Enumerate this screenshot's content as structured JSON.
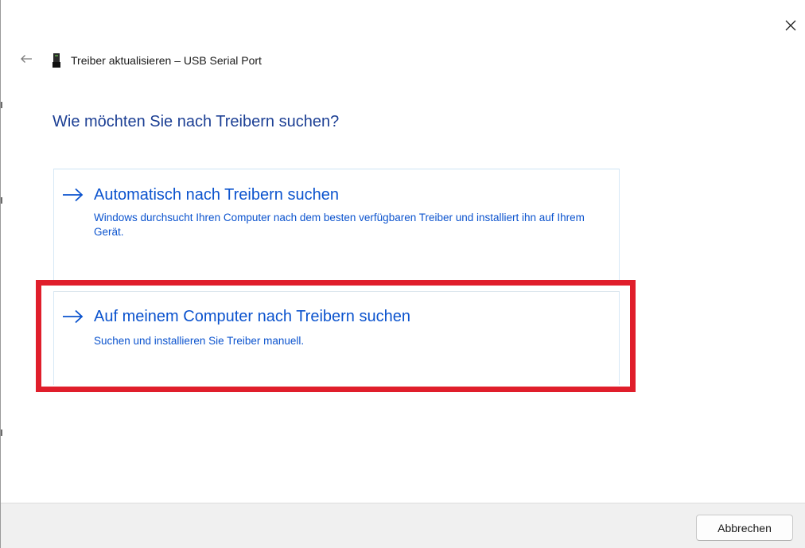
{
  "window": {
    "title": "Treiber aktualisieren – USB Serial Port"
  },
  "icons": {
    "close": "close-icon",
    "back": "back-arrow-icon",
    "device": "usb-device-icon",
    "option_arrow": "right-arrow-icon"
  },
  "main": {
    "heading": "Wie möchten Sie nach Treibern suchen?",
    "options": [
      {
        "title": "Automatisch nach Treibern suchen",
        "description": "Windows durchsucht Ihren Computer nach dem besten verfügbaren Treiber und installiert ihn auf Ihrem Gerät."
      },
      {
        "title": "Auf meinem Computer nach Treibern suchen",
        "description": "Suchen und installieren Sie Treiber manuell.",
        "highlighted": true
      }
    ]
  },
  "footer": {
    "cancel_label": "Abbrechen"
  },
  "colors": {
    "heading": "#1c3f94",
    "link": "#0b53ce",
    "highlight": "#e01e2b",
    "footer_bg": "#f0f0f0"
  }
}
